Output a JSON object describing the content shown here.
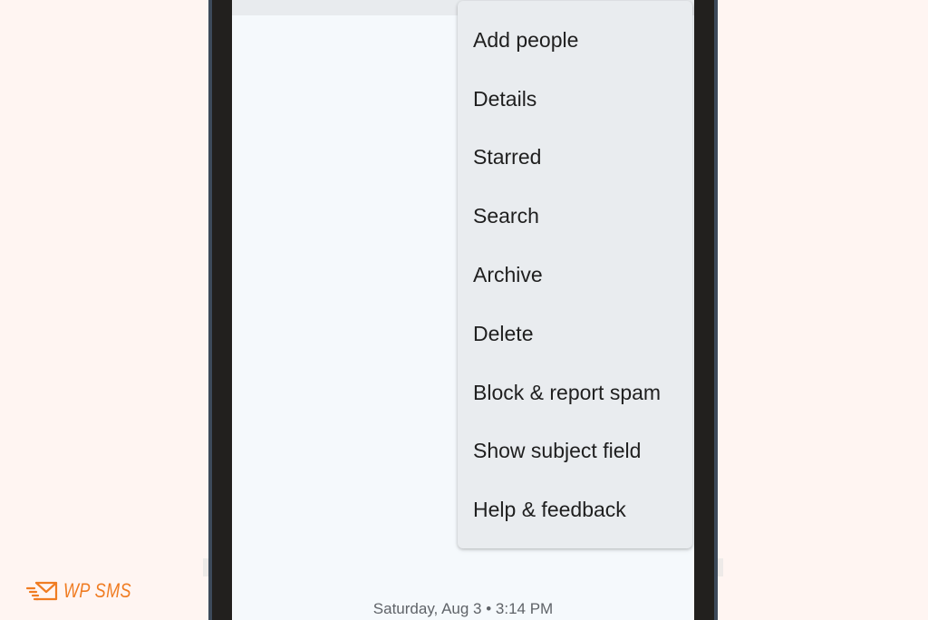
{
  "menu": {
    "items": [
      {
        "label": "Add people"
      },
      {
        "label": "Details"
      },
      {
        "label": "Starred"
      },
      {
        "label": "Search"
      },
      {
        "label": "Archive"
      },
      {
        "label": "Delete"
      },
      {
        "label": "Block & report spam"
      },
      {
        "label": "Show subject field"
      },
      {
        "label": "Help & feedback"
      }
    ]
  },
  "conversation": {
    "timestamp": "Saturday, Aug 3 • 3:14 PM"
  },
  "brand": {
    "name": "WP SMS",
    "icon": "envelope-fast-icon",
    "color": "#f07c22"
  }
}
